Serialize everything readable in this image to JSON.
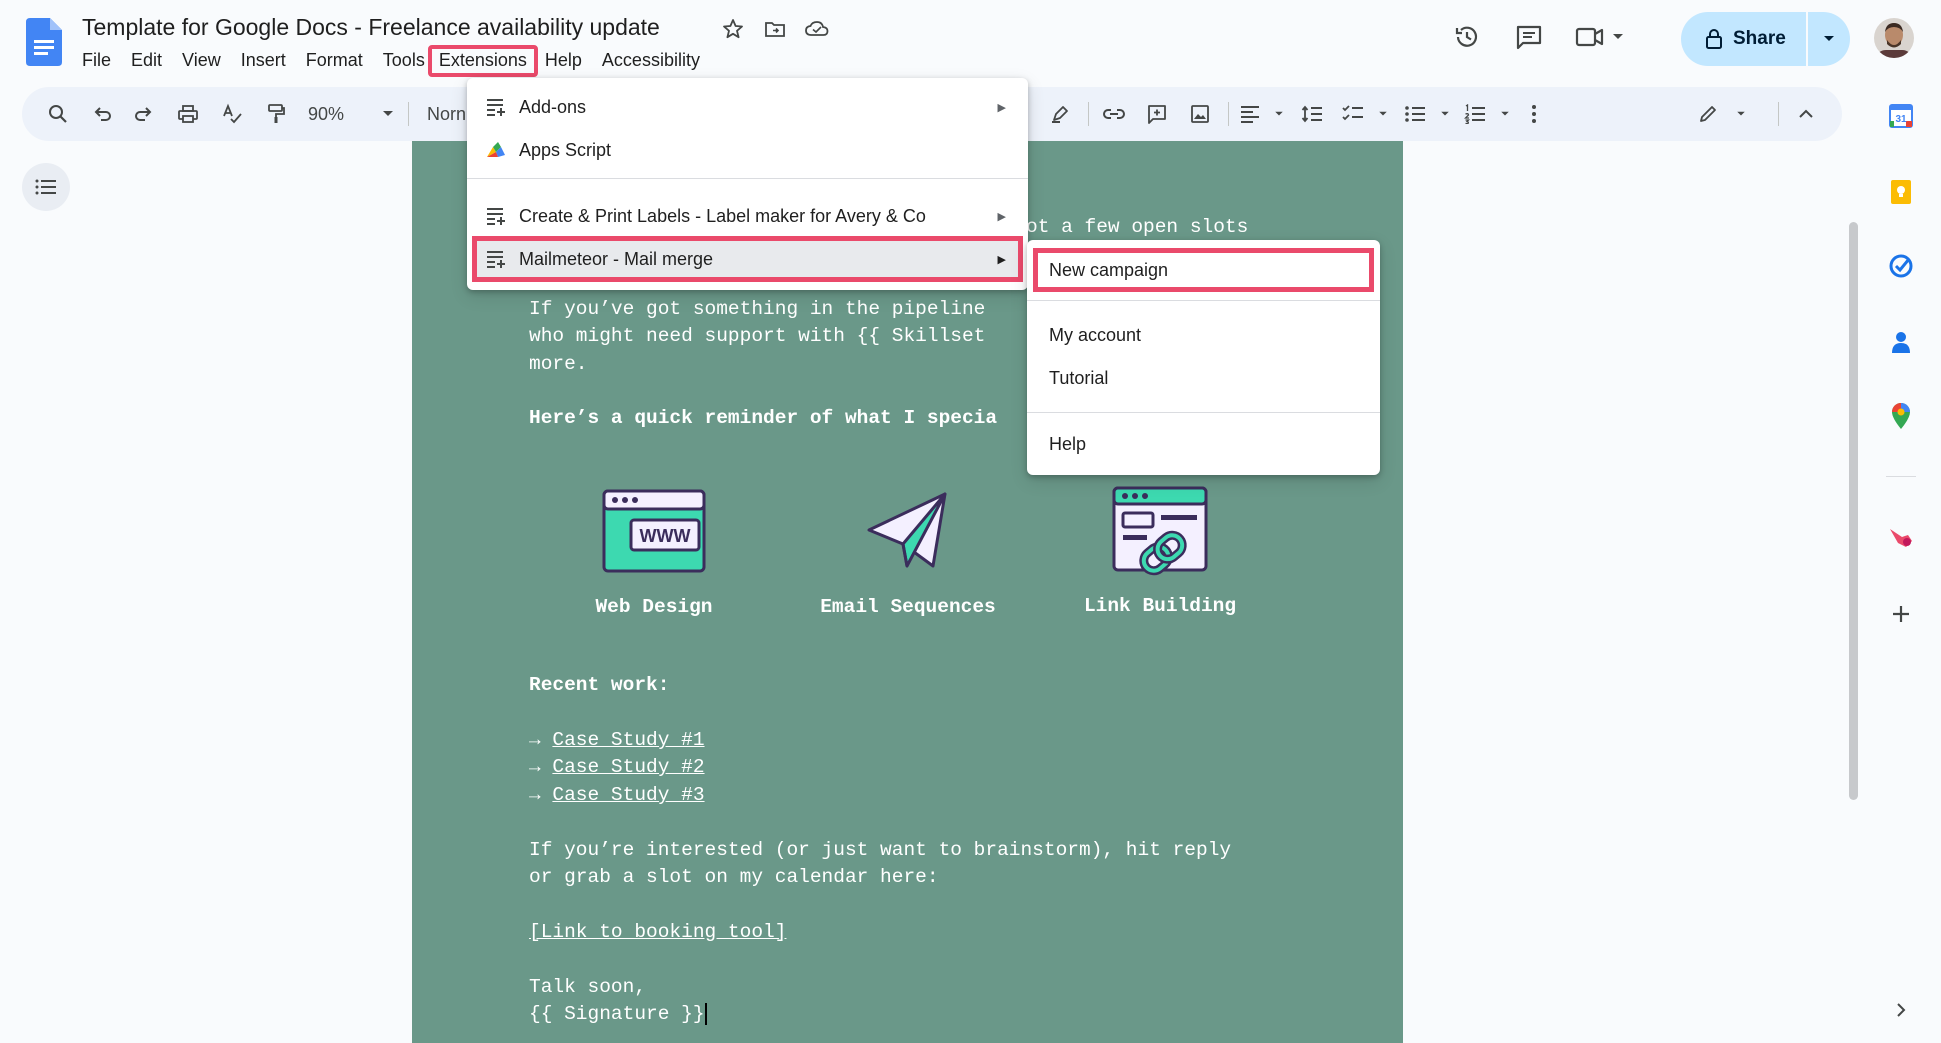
{
  "app": {
    "title": "Template for Google Docs - Freelance availability update",
    "menus": [
      "File",
      "Edit",
      "View",
      "Insert",
      "Format",
      "Tools",
      "Extensions",
      "Help",
      "Accessibility"
    ],
    "highlighted_menu": "Extensions",
    "share_label": "Share"
  },
  "toolbar": {
    "zoom": "90%",
    "style_partial": "Norn"
  },
  "extensions_menu": {
    "items": [
      {
        "label": "Add-ons",
        "icon": "addons-icon",
        "submenu": true
      },
      {
        "label": "Apps Script",
        "icon": "apps-script-icon",
        "submenu": false
      },
      {
        "label": "Create & Print Labels - Label maker for Avery & Co",
        "icon": "addon-list-icon",
        "submenu": true
      },
      {
        "label": "Mailmeteor - Mail merge",
        "icon": "addon-list-icon",
        "submenu": true,
        "highlighted": true
      }
    ]
  },
  "mailmeteor_submenu": {
    "items": [
      "New campaign",
      "My account",
      "Tutorial",
      "Help"
    ],
    "highlighted": "New campaign"
  },
  "document": {
    "line_open_slots": "ot a few open slots",
    "para1_line1": "If you’ve got something in the pipeline",
    "para1_line2": "who might need support with {{ Skillset",
    "para1_line3": "more.",
    "reminder": "Here’s a quick reminder of what I specia",
    "features": [
      "Web Design",
      "Email Sequences",
      "Link Building"
    ],
    "recent_work_heading": "Recent work:",
    "arrow": "→",
    "case_studies": [
      "Case Study #1",
      "Case Study #2",
      "Case Study #3"
    ],
    "para2_line1": "If you’re interested (or just want to brainstorm), hit reply",
    "para2_line2": "or grab a slot on my calendar here:",
    "booking_link": "[Link to booking tool]",
    "signoff": "Talk soon,",
    "signature": "{{ Signature }}"
  },
  "colors": {
    "page_background": "#6a9889",
    "highlight_outline": "#ea4a6b",
    "share_button": "#c2e7ff",
    "docs_blue": "#4285f4"
  }
}
